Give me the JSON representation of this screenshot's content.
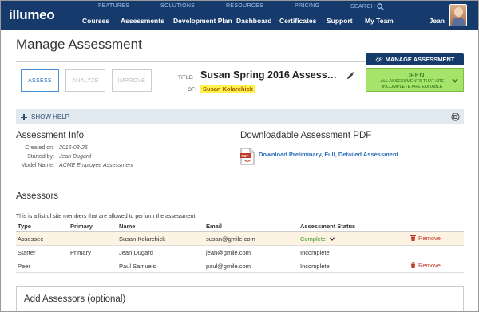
{
  "logo": "illumeo",
  "utility_nav": [
    "FEATURES",
    "SOLUTIONS",
    "RESOURCES",
    "PRICING",
    "SEARCH"
  ],
  "main_nav": [
    "Courses",
    "Assessments",
    "Development Plan",
    "Dashboard",
    "Certificates",
    "Support",
    "My Team"
  ],
  "user": {
    "name": "Jean"
  },
  "page": {
    "title": "Manage Assessment"
  },
  "manage_button": "MANAGE ASSESSMENT",
  "tabs": [
    "ASSESS",
    "ANALYZE",
    "IMPROVE"
  ],
  "assessment": {
    "title_label": "TITLE:",
    "title": "Susan Spring 2016 Assess…",
    "of_label": "OF:",
    "of_name": "Susan Kolarchick"
  },
  "status": {
    "main": "OPEN",
    "sub": "ALL ASSESSMENTS THAT ARE INCOMPLETE ARE EDITABLE"
  },
  "help": {
    "label": "SHOW HELP"
  },
  "info": {
    "heading": "Assessment Info",
    "created_label": "Created on:",
    "created": "2016-03-25",
    "started_label": "Started by:",
    "started": "Jean Dugard",
    "model_label": "Model Name:",
    "model": "ACME Employee Assessment"
  },
  "pdf": {
    "heading": "Downloadable Assessment PDF",
    "link": "Download Preliminary, Full, Detailed Assessment"
  },
  "assessors": {
    "heading": "Assessors",
    "description": "This is a list of site members that are allowed to perform the assessment",
    "columns": [
      "Type",
      "Primary",
      "Name",
      "Email",
      "Assessment Status",
      ""
    ],
    "rows": [
      {
        "type": "Assessee",
        "primary": "",
        "name": "Susan Kolarchick",
        "email": "susan@gmile.com",
        "status": "Complete",
        "action": "Remove"
      },
      {
        "type": "Starter",
        "primary": "Primary",
        "name": "Jean Dugard",
        "email": "jean@gmile.com",
        "status": "Incomplete",
        "action": ""
      },
      {
        "type": "Peer",
        "primary": "",
        "name": "Paul Samuels",
        "email": "paul@gmile.com",
        "status": "Incomplete",
        "action": "Remove"
      }
    ]
  },
  "add_assessors": {
    "heading": "Add Assessors (optional)"
  },
  "colors": {
    "nav_bg": "#153a6b",
    "status_bg": "#a6e36a",
    "highlight": "#fff24d",
    "link": "#2a6ebb",
    "remove": "#c0392b"
  }
}
